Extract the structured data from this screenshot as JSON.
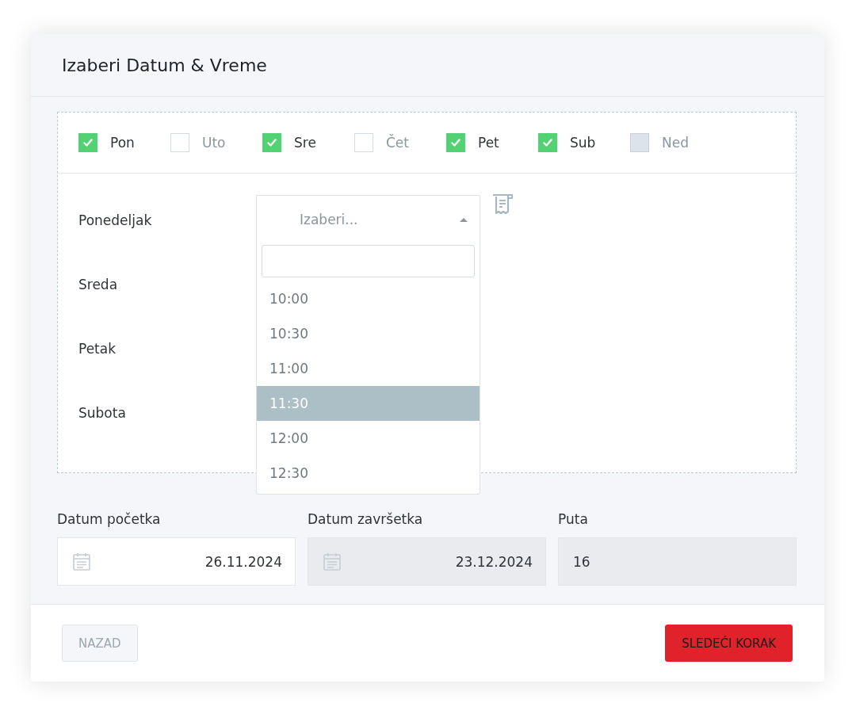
{
  "dialog": {
    "title": "Izaberi Datum & Vreme"
  },
  "days": [
    {
      "label": "Pon",
      "checked": true,
      "disabled": false
    },
    {
      "label": "Uto",
      "checked": false,
      "disabled": false
    },
    {
      "label": "Sre",
      "checked": true,
      "disabled": false
    },
    {
      "label": "Čet",
      "checked": false,
      "disabled": false
    },
    {
      "label": "Pet",
      "checked": true,
      "disabled": false
    },
    {
      "label": "Sub",
      "checked": true,
      "disabled": false
    },
    {
      "label": "Ned",
      "checked": false,
      "disabled": true
    }
  ],
  "schedule": [
    {
      "day": "Ponedeljak"
    },
    {
      "day": "Sreda"
    },
    {
      "day": "Petak"
    },
    {
      "day": "Subota"
    }
  ],
  "time_select": {
    "placeholder": "Izaberi...",
    "expanded": true,
    "options": [
      {
        "label": "10:00",
        "selected": false
      },
      {
        "label": "10:30",
        "selected": false
      },
      {
        "label": "11:00",
        "selected": false
      },
      {
        "label": "11:30",
        "selected": true
      },
      {
        "label": "12:00",
        "selected": false
      },
      {
        "label": "12:30",
        "selected": false
      }
    ]
  },
  "fields": [
    {
      "label": "Datum početka",
      "value": "26.11.2024",
      "kind": "date",
      "disabled": false
    },
    {
      "label": "Datum završetka",
      "value": "23.12.2024",
      "kind": "date",
      "disabled": true
    },
    {
      "label": "Puta",
      "value": "16",
      "kind": "number",
      "disabled": true
    }
  ],
  "buttons": [
    {
      "label": "NAZAD",
      "kind": "secondary",
      "disabled": true
    },
    {
      "label": "SLEDEĆI KORAK",
      "kind": "primary",
      "disabled": false
    }
  ]
}
